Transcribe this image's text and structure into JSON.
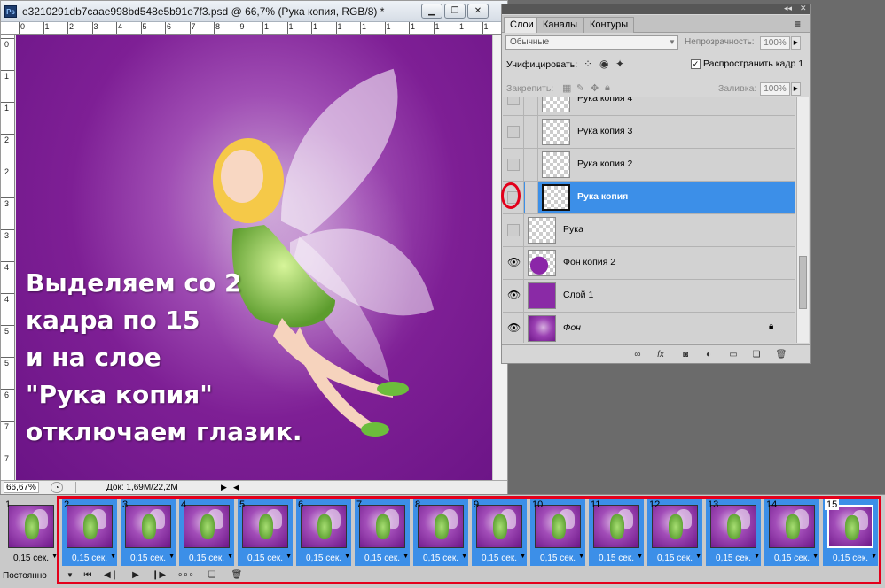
{
  "document": {
    "title": "e3210291db7caae998bd548e5b91e7f3.psd @ 66,7% (Рука копия, RGB/8) *",
    "app_icon": "Ps",
    "window_buttons": [
      "minimize-icon",
      "restore-icon",
      "close-icon"
    ],
    "zoom": "66,67%",
    "doc_info": "Док: 1,69M/22,2M",
    "ruler_h": [
      "0",
      "1",
      "2",
      "3",
      "4",
      "5",
      "6",
      "7",
      "8",
      "9",
      "1",
      "1",
      "1",
      "1",
      "1",
      "1",
      "1",
      "1",
      "1",
      "1"
    ],
    "ruler_v": [
      "0",
      "1",
      "1",
      "2",
      "2",
      "3",
      "3",
      "4",
      "4",
      "5",
      "5",
      "6",
      "7",
      "7"
    ],
    "overlay_lines": "Выделяем со 2\nкадра по 15\nи на слое\n\"Рука копия\"\nотключаем глазик.",
    "canvas_color": "#7e1f95"
  },
  "layers_panel": {
    "tabs": [
      "Слои",
      "Каналы",
      "Контуры"
    ],
    "blend_mode": "Обычные",
    "opacity_label": "Непрозрачность:",
    "opacity_value": "100%",
    "unify_label": "Унифицировать:",
    "propagate_label": "Распространить кадр 1",
    "propagate_checked": "✓",
    "lock_label": "Закрепить:",
    "fill_label": "Заливка:",
    "fill_value": "100%",
    "layers": [
      {
        "name": "Рука копия 4",
        "visible": false,
        "selected": false,
        "thumb": "transparent",
        "indent": true
      },
      {
        "name": "Рука копия 3",
        "visible": false,
        "selected": false,
        "thumb": "transparent",
        "indent": true
      },
      {
        "name": "Рука копия 2",
        "visible": false,
        "selected": false,
        "thumb": "transparent",
        "indent": true
      },
      {
        "name": "Рука копия",
        "visible": false,
        "selected": true,
        "thumb": "transparent",
        "indent": true
      },
      {
        "name": "Рука",
        "visible": false,
        "selected": false,
        "thumb": "transparent",
        "indent": false
      },
      {
        "name": "Фон копия 2",
        "visible": true,
        "selected": false,
        "thumb": "purple-blob",
        "indent": false
      },
      {
        "name": "Слой 1",
        "visible": true,
        "selected": false,
        "thumb": "purple",
        "indent": false
      },
      {
        "name": "Фон",
        "visible": true,
        "selected": false,
        "thumb": "fairy",
        "indent": false,
        "locked": true
      }
    ],
    "bottom_icons": [
      "link-icon",
      "fx-icon",
      "mask-icon",
      "adjustment-icon",
      "group-icon",
      "new-layer-icon",
      "trash-icon"
    ]
  },
  "animation": {
    "frames": [
      {
        "num": "1",
        "time": "0,15 сек."
      },
      {
        "num": "2",
        "time": "0,15 сек."
      },
      {
        "num": "3",
        "time": "0,15 сек."
      },
      {
        "num": "4",
        "time": "0,15 сек."
      },
      {
        "num": "5",
        "time": "0,15 сек."
      },
      {
        "num": "6",
        "time": "0,15 сек."
      },
      {
        "num": "7",
        "time": "0,15 сек."
      },
      {
        "num": "8",
        "time": "0,15 сек."
      },
      {
        "num": "9",
        "time": "0,15 сек."
      },
      {
        "num": "10",
        "time": "0,15 сек."
      },
      {
        "num": "11",
        "time": "0,15 сек."
      },
      {
        "num": "12",
        "time": "0,15 сек."
      },
      {
        "num": "13",
        "time": "0,15 сек."
      },
      {
        "num": "14",
        "time": "0,15 сек."
      },
      {
        "num": "15",
        "time": "0,15 сек."
      }
    ],
    "loop": "Постоянно",
    "controls": [
      "first-frame-icon",
      "prev-frame-icon",
      "play-icon",
      "next-frame-icon",
      "tween-icon",
      "duplicate-frame-icon",
      "delete-frame-icon"
    ]
  },
  "colors": {
    "highlight": "#3c8fe8",
    "annotation": "#e3001b"
  }
}
